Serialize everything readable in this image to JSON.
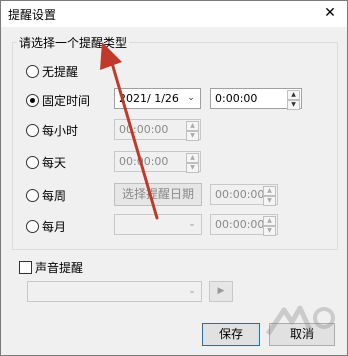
{
  "window": {
    "title": "提醒设置",
    "close_glyph": "✕"
  },
  "group": {
    "title": "请选择一个提醒类型",
    "options": [
      {
        "label": "无提醒",
        "checked": false
      },
      {
        "label": "固定时间",
        "checked": true
      },
      {
        "label": "每小时",
        "checked": false
      },
      {
        "label": "每天",
        "checked": false
      },
      {
        "label": "每周",
        "checked": false
      },
      {
        "label": "每月",
        "checked": false
      }
    ],
    "fixed_date": "2021/  1/26",
    "fixed_time": "0:00:00",
    "hourly_time": "00:00:00",
    "daily_time": "00:00:00",
    "weekly_button": "选择提醒日期",
    "weekly_time": "00:00:00",
    "monthly_time": "00:00:00"
  },
  "sound": {
    "label": "声音提醒",
    "checked": false,
    "play_glyph": "▶"
  },
  "buttons": {
    "save": "保存",
    "cancel": "取消"
  },
  "icons": {
    "spin_up": "▲",
    "spin_down": "▼",
    "dropdown": "⌄"
  },
  "colors": {
    "arrow": "#c0392b",
    "focus_border": "#0078d7"
  }
}
